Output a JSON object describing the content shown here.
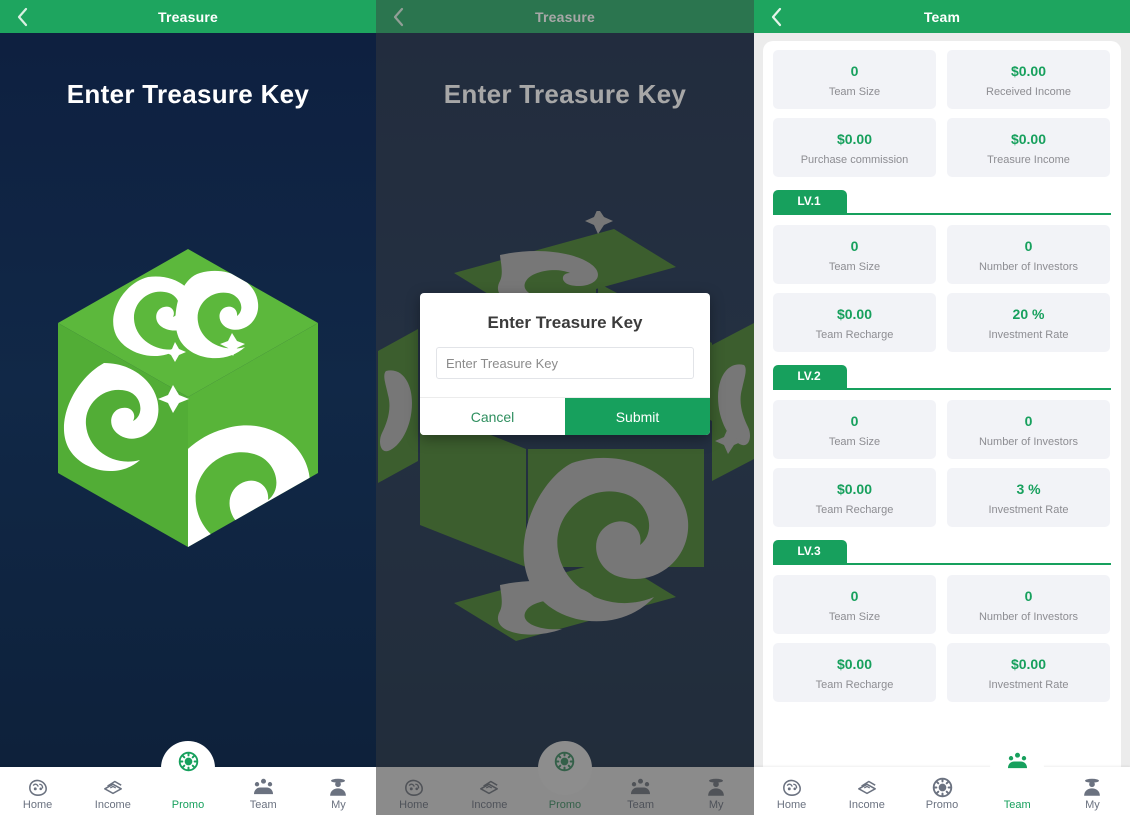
{
  "colors": {
    "brand_green": "#1ea55f",
    "deep_green": "#17a05d",
    "cube_green": "#57b53a",
    "dark_navy": "#112847",
    "stat_bg": "#f2f3f7",
    "muted_text": "#8d8d92"
  },
  "panel_treasure": {
    "header": {
      "title": "Treasure",
      "back_icon": "chevron-left-icon"
    },
    "heading": "Enter Treasure Key",
    "graphic": "treasure-cube-icon",
    "nav": {
      "items": [
        {
          "label": "Home",
          "icon": "home-icon",
          "active": false,
          "raised": false
        },
        {
          "label": "Income",
          "icon": "income-icon",
          "active": false,
          "raised": false
        },
        {
          "label": "Promo",
          "icon": "promo-icon",
          "active": true,
          "raised": true
        },
        {
          "label": "Team",
          "icon": "team-icon",
          "active": false,
          "raised": false
        },
        {
          "label": "My",
          "icon": "my-icon",
          "active": false,
          "raised": false
        }
      ]
    }
  },
  "panel_dialog": {
    "header": {
      "title": "Treasure",
      "back_icon": "chevron-left-icon"
    },
    "heading": "Enter Treasure Key",
    "graphic": "treasure-cube-exploded-icon",
    "dialog": {
      "title": "Enter Treasure Key",
      "input_value": "",
      "input_placeholder": "Enter Treasure Key",
      "cancel_label": "Cancel",
      "submit_label": "Submit"
    },
    "nav": {
      "items": [
        {
          "label": "Home",
          "icon": "home-icon",
          "active": false,
          "raised": false
        },
        {
          "label": "Income",
          "icon": "income-icon",
          "active": false,
          "raised": false
        },
        {
          "label": "Promo",
          "icon": "promo-icon",
          "active": true,
          "raised": true
        },
        {
          "label": "Team",
          "icon": "team-icon",
          "active": false,
          "raised": false
        },
        {
          "label": "My",
          "icon": "my-icon",
          "active": false,
          "raised": false
        }
      ]
    }
  },
  "panel_team": {
    "header": {
      "title": "Team",
      "back_icon": "chevron-left-icon"
    },
    "summary": [
      {
        "value": "0",
        "label": "Team Size"
      },
      {
        "value": "$0.00",
        "label": "Received Income"
      },
      {
        "value": "$0.00",
        "label": "Purchase commission"
      },
      {
        "value": "$0.00",
        "label": "Treasure Income"
      }
    ],
    "levels": [
      {
        "tab": "LV.1",
        "stats": [
          {
            "value": "0",
            "label": "Team Size"
          },
          {
            "value": "0",
            "label": "Number of Investors"
          },
          {
            "value": "$0.00",
            "label": "Team Recharge"
          },
          {
            "value": "20 %",
            "label": "Investment Rate"
          }
        ]
      },
      {
        "tab": "LV.2",
        "stats": [
          {
            "value": "0",
            "label": "Team Size"
          },
          {
            "value": "0",
            "label": "Number of Investors"
          },
          {
            "value": "$0.00",
            "label": "Team Recharge"
          },
          {
            "value": "3 %",
            "label": "Investment Rate"
          }
        ]
      },
      {
        "tab": "LV.3",
        "stats": [
          {
            "value": "0",
            "label": "Team Size"
          },
          {
            "value": "0",
            "label": "Number of Investors"
          },
          {
            "value": "$0.00",
            "label": "Team Recharge"
          },
          {
            "value": "$0.00",
            "label": "Investment Rate"
          }
        ]
      }
    ],
    "nav": {
      "items": [
        {
          "label": "Home",
          "icon": "home-icon",
          "active": false,
          "raised": false
        },
        {
          "label": "Income",
          "icon": "income-icon",
          "active": false,
          "raised": false
        },
        {
          "label": "Promo",
          "icon": "promo-icon",
          "active": false,
          "raised": false
        },
        {
          "label": "Team",
          "icon": "team-icon",
          "active": true,
          "raised": true
        },
        {
          "label": "My",
          "icon": "my-icon",
          "active": false,
          "raised": false
        }
      ]
    }
  }
}
